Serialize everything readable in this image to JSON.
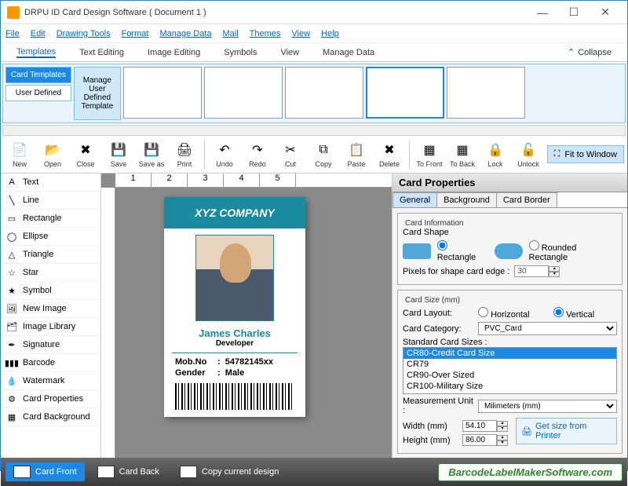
{
  "window": {
    "title": "DRPU ID Card Design Software ( Document 1 )"
  },
  "menu": [
    "File",
    "Edit",
    "Drawing Tools",
    "Format",
    "Manage Data",
    "Mail",
    "Themes",
    "View",
    "Help"
  ],
  "ribbon_tabs": [
    "Templates",
    "Text Editing",
    "Image Editing",
    "Symbols",
    "View",
    "Manage Data"
  ],
  "collapse": "Collapse",
  "ribbon": {
    "card_templates": "Card Templates",
    "user_defined": "User Defined",
    "manage": "Manage User Defined Template"
  },
  "toolbar": [
    "New",
    "Open",
    "Close",
    "Save",
    "Save as",
    "Print",
    "Undo",
    "Redo",
    "Cut",
    "Copy",
    "Paste",
    "Delete",
    "To Front",
    "To Back",
    "Lock",
    "Unlock"
  ],
  "fit": "Fit to Window",
  "tools": [
    "Text",
    "Line",
    "Rectangle",
    "Ellipse",
    "Triangle",
    "Star",
    "Symbol",
    "New Image",
    "Image Library",
    "Signature",
    "Barcode",
    "Watermark",
    "Card Properties",
    "Card Background"
  ],
  "ruler": [
    "1",
    "2",
    "3",
    "4",
    "5"
  ],
  "card": {
    "company": "XYZ COMPANY",
    "name": "James Charles",
    "role": "Developer",
    "mob_k": "Mob.No",
    "mob_v": "54782145xx",
    "gen_k": "Gender",
    "gen_v": "Male"
  },
  "props": {
    "title": "Card Properties",
    "tabs": [
      "General",
      "Background",
      "Card Border"
    ],
    "fs1": "Card Information",
    "shape_lbl": "Card Shape",
    "rect": "Rectangle",
    "rrect": "Rounded Rectangle",
    "px_lbl": "Pixels for shape card edge :",
    "px_val": "30",
    "fs2": "Card Size (mm)",
    "layout_lbl": "Card Layout:",
    "h": "Horizontal",
    "v": "Vertical",
    "cat_lbl": "Card Category:",
    "cat_val": "PVC_Card",
    "sizes_lbl": "Standard Card Sizes :",
    "sizes": [
      "CR80-Credit Card Size",
      "CR79",
      "CR90-Over Sized",
      "CR100-Military Size"
    ],
    "unit_lbl": "Measurement Unit :",
    "unit_val": "Milimeters (mm)",
    "w_lbl": "Width  (mm)",
    "w_val": "54.10",
    "h_lbl": "Height (mm)",
    "h_val": "86.00",
    "getsize": "Get size from Printer"
  },
  "bottom": {
    "front": "Card Front",
    "back": "Card Back",
    "copy": "Copy current design",
    "brand": "BarcodeLabelMakerSoftware.com"
  }
}
